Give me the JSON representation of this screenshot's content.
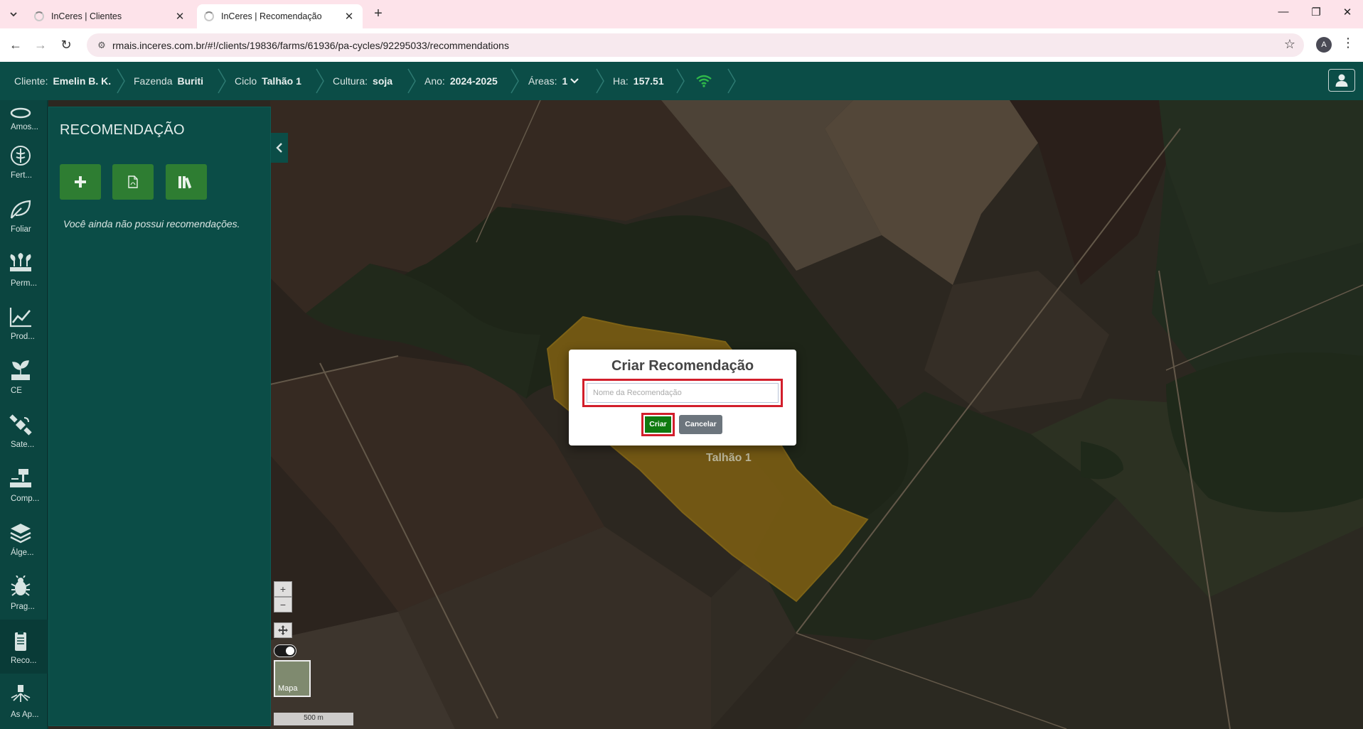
{
  "browser": {
    "tabs": [
      {
        "title": "InCeres | Clientes",
        "active": false
      },
      {
        "title": "InCeres | Recomendação",
        "active": true
      }
    ],
    "url": "rmais.inceres.com.br/#!/clients/19836/farms/61936/pa-cycles/92295033/recommendations",
    "profile_initial": "A"
  },
  "header": {
    "cliente_label": "Cliente:",
    "cliente_value": "Emelin B. K.",
    "fazenda_label": "Fazenda",
    "fazenda_value": "Buriti",
    "ciclo_label": "Ciclo",
    "ciclo_value": "Talhão 1",
    "cultura_label": "Cultura:",
    "cultura_value": "soja",
    "ano_label": "Ano:",
    "ano_value": "2024-2025",
    "areas_label": "Áreas:",
    "areas_value": "1",
    "ha_label": "Ha:",
    "ha_value": "157.51"
  },
  "rail": {
    "items": [
      {
        "label": "Amos...",
        "icon": "sample-icon"
      },
      {
        "label": "Fert...",
        "icon": "fertilizer-icon"
      },
      {
        "label": "Foliar",
        "icon": "leaf-icon"
      },
      {
        "label": "Perm...",
        "icon": "plants-icon"
      },
      {
        "label": "Prod...",
        "icon": "chart-line-icon"
      },
      {
        "label": "CE",
        "icon": "sprout-icon"
      },
      {
        "label": "Sate...",
        "icon": "satellite-icon"
      },
      {
        "label": "Comp...",
        "icon": "compaction-icon"
      },
      {
        "label": "Álge...",
        "icon": "layers-icon"
      },
      {
        "label": "Prag...",
        "icon": "bug-icon"
      },
      {
        "label": "Reco...",
        "icon": "clipboard-icon",
        "active": true
      },
      {
        "label": "As Ap...",
        "icon": "sprayer-icon"
      }
    ]
  },
  "panel": {
    "title": "RECOMENDAÇÃO",
    "empty_text": "Você ainda não possui recomendações."
  },
  "map": {
    "field_label": "Talhão 1",
    "scale_label": "500 m",
    "thumb_label": "Mapa",
    "zoom_in": "+",
    "zoom_out": "−"
  },
  "modal": {
    "title": "Criar Recomendação",
    "input_value": "",
    "input_placeholder": "Nome da Recomendação",
    "create_label": "Criar",
    "cancel_label": "Cancelar"
  },
  "colors": {
    "header_bg": "#0b4d47",
    "accent_green": "#2e7d32",
    "highlight_red": "#d21e2b",
    "field_highlight": "#b8860b"
  }
}
